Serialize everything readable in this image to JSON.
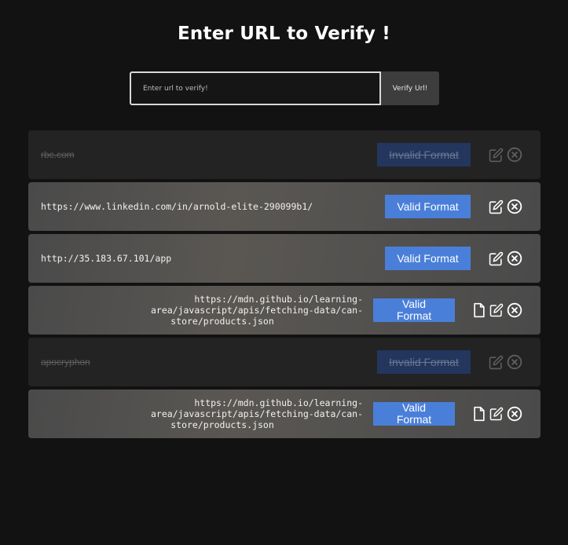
{
  "page": {
    "title": "Enter URL to Verify !"
  },
  "form": {
    "placeholder": "Enter url to verify!",
    "button_label": "Verify Url!"
  },
  "colors": {
    "valid_badge": "#4a7fd9",
    "invalid_badge": "#22365e",
    "background": "#121212"
  },
  "rows": [
    {
      "url": "rbc.com",
      "status": "Invalid Format",
      "valid": false
    },
    {
      "url": "https://www.linkedin.com/in/arnold-elite-290099b1/",
      "status": "Valid Format",
      "valid": true
    },
    {
      "url": "http://35.183.67.101/app",
      "status": "Valid Format",
      "valid": true
    },
    {
      "url_line1": "https://mdn.github.io/learning-area/javascript/apis/fetching-data/can-",
      "url_line2": "store/products.json",
      "status_line1": "Valid",
      "status_line2": "Format",
      "valid": true
    },
    {
      "url": "apocryphon",
      "status": "Invalid Format",
      "valid": false
    },
    {
      "url_line1": "https://mdn.github.io/learning-area/javascript/apis/fetching-data/can-",
      "url_line2": "store/products.json",
      "status_line1": "Valid",
      "status_line2": "Format",
      "valid": true
    }
  ],
  "icons": {
    "edit": "edit-icon",
    "delete": "close-circle-icon",
    "file": "file-icon"
  }
}
